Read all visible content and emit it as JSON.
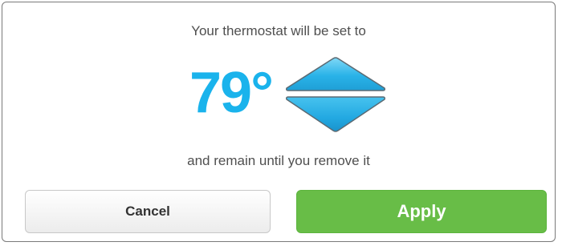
{
  "dialog": {
    "heading": "Your thermostat will be set to",
    "temperature": "79°",
    "subtext": "and remain until you remove it"
  },
  "buttons": {
    "cancel_label": "Cancel",
    "apply_label": "Apply"
  },
  "colors": {
    "temperature": "#1ab3ec",
    "arrow": "#35b7e8",
    "apply": "#68bd47"
  },
  "icons": {
    "up": "triangle-up-icon",
    "down": "triangle-down-icon"
  }
}
